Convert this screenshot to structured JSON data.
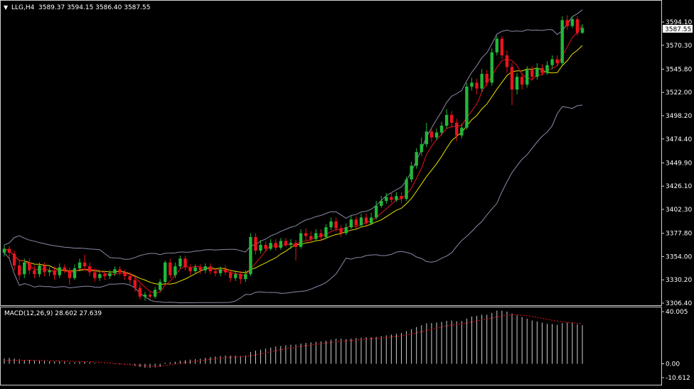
{
  "header": {
    "marker": "▼",
    "symbol": "LLG,H4",
    "ohlc": "3589.37 3594.15 3586.40 3587.55"
  },
  "price_axis": {
    "ticks": [
      "3594.10",
      "3570.30",
      "3545.80",
      "3522.00",
      "3498.20",
      "3474.40",
      "3449.90",
      "3426.10",
      "3402.30",
      "3377.80",
      "3354.00",
      "3330.20",
      "3306.40"
    ],
    "current_label": "3587.55"
  },
  "macd": {
    "label": "MACD(12,26,9) 28.602 27.639",
    "ticks": [
      "40.005",
      "0.00",
      "-10.612"
    ]
  },
  "colors": {
    "bull": "#22b83a",
    "bear": "#e8141e",
    "fast_ma": "#e8141e",
    "slow_ma": "#e6e000",
    "bands": "#8a8aa8",
    "hist": "#cfcfcf",
    "signal": "#e8141e"
  },
  "chart_data": {
    "type": "candlestick",
    "timeframe": "H4",
    "ylim": [
      3306.4,
      3606
    ],
    "candles": [
      {
        "o": 3358,
        "c": 3362,
        "h": 3366,
        "l": 3354
      },
      {
        "o": 3362,
        "c": 3358,
        "h": 3365,
        "l": 3352
      },
      {
        "o": 3357,
        "c": 3345,
        "h": 3360,
        "l": 3340
      },
      {
        "o": 3345,
        "c": 3335,
        "h": 3350,
        "l": 3330
      },
      {
        "o": 3336,
        "c": 3348,
        "h": 3352,
        "l": 3332
      },
      {
        "o": 3348,
        "c": 3340,
        "h": 3352,
        "l": 3336
      },
      {
        "o": 3340,
        "c": 3336,
        "h": 3345,
        "l": 3332
      },
      {
        "o": 3336,
        "c": 3345,
        "h": 3348,
        "l": 3333
      },
      {
        "o": 3345,
        "c": 3338,
        "h": 3348,
        "l": 3334
      },
      {
        "o": 3338,
        "c": 3340,
        "h": 3343,
        "l": 3334
      },
      {
        "o": 3340,
        "c": 3335,
        "h": 3344,
        "l": 3330
      },
      {
        "o": 3335,
        "c": 3343,
        "h": 3347,
        "l": 3332
      },
      {
        "o": 3343,
        "c": 3340,
        "h": 3346,
        "l": 3337
      },
      {
        "o": 3340,
        "c": 3332,
        "h": 3343,
        "l": 3325
      },
      {
        "o": 3332,
        "c": 3342,
        "h": 3346,
        "l": 3330
      },
      {
        "o": 3342,
        "c": 3348,
        "h": 3352,
        "l": 3339
      },
      {
        "o": 3348,
        "c": 3344,
        "h": 3356,
        "l": 3340
      },
      {
        "o": 3344,
        "c": 3338,
        "h": 3348,
        "l": 3334
      },
      {
        "o": 3338,
        "c": 3332,
        "h": 3342,
        "l": 3328
      },
      {
        "o": 3332,
        "c": 3336,
        "h": 3340,
        "l": 3329
      },
      {
        "o": 3336,
        "c": 3334,
        "h": 3339,
        "l": 3330
      },
      {
        "o": 3334,
        "c": 3337,
        "h": 3340,
        "l": 3331
      },
      {
        "o": 3337,
        "c": 3341,
        "h": 3344,
        "l": 3334
      },
      {
        "o": 3341,
        "c": 3338,
        "h": 3344,
        "l": 3335
      },
      {
        "o": 3338,
        "c": 3334,
        "h": 3341,
        "l": 3330
      },
      {
        "o": 3334,
        "c": 3330,
        "h": 3338,
        "l": 3326
      },
      {
        "o": 3330,
        "c": 3322,
        "h": 3333,
        "l": 3318
      },
      {
        "o": 3322,
        "c": 3313,
        "h": 3326,
        "l": 3310
      },
      {
        "o": 3313,
        "c": 3315,
        "h": 3318,
        "l": 3309
      },
      {
        "o": 3315,
        "c": 3313,
        "h": 3318,
        "l": 3310
      },
      {
        "o": 3313,
        "c": 3320,
        "h": 3323,
        "l": 3311
      },
      {
        "o": 3320,
        "c": 3328,
        "h": 3331,
        "l": 3318
      },
      {
        "o": 3328,
        "c": 3348,
        "h": 3350,
        "l": 3326
      },
      {
        "o": 3348,
        "c": 3335,
        "h": 3352,
        "l": 3332
      },
      {
        "o": 3335,
        "c": 3344,
        "h": 3348,
        "l": 3332
      },
      {
        "o": 3344,
        "c": 3352,
        "h": 3355,
        "l": 3342
      },
      {
        "o": 3352,
        "c": 3343,
        "h": 3355,
        "l": 3340
      },
      {
        "o": 3343,
        "c": 3339,
        "h": 3346,
        "l": 3335
      },
      {
        "o": 3339,
        "c": 3343,
        "h": 3346,
        "l": 3336
      },
      {
        "o": 3343,
        "c": 3340,
        "h": 3346,
        "l": 3336
      },
      {
        "o": 3340,
        "c": 3344,
        "h": 3347,
        "l": 3337
      },
      {
        "o": 3344,
        "c": 3339,
        "h": 3347,
        "l": 3336
      },
      {
        "o": 3339,
        "c": 3337,
        "h": 3342,
        "l": 3334
      },
      {
        "o": 3337,
        "c": 3341,
        "h": 3344,
        "l": 3334
      },
      {
        "o": 3341,
        "c": 3338,
        "h": 3345,
        "l": 3335
      },
      {
        "o": 3338,
        "c": 3332,
        "h": 3341,
        "l": 3328
      },
      {
        "o": 3332,
        "c": 3336,
        "h": 3340,
        "l": 3329
      },
      {
        "o": 3336,
        "c": 3331,
        "h": 3339,
        "l": 3326
      },
      {
        "o": 3331,
        "c": 3336,
        "h": 3340,
        "l": 3328
      },
      {
        "o": 3336,
        "c": 3374,
        "h": 3378,
        "l": 3334
      },
      {
        "o": 3374,
        "c": 3360,
        "h": 3378,
        "l": 3356
      },
      {
        "o": 3360,
        "c": 3366,
        "h": 3371,
        "l": 3357
      },
      {
        "o": 3366,
        "c": 3362,
        "h": 3370,
        "l": 3359
      },
      {
        "o": 3362,
        "c": 3368,
        "h": 3372,
        "l": 3360
      },
      {
        "o": 3368,
        "c": 3363,
        "h": 3372,
        "l": 3360
      },
      {
        "o": 3363,
        "c": 3370,
        "h": 3373,
        "l": 3361
      },
      {
        "o": 3370,
        "c": 3366,
        "h": 3373,
        "l": 3364
      },
      {
        "o": 3366,
        "c": 3368,
        "h": 3372,
        "l": 3362
      },
      {
        "o": 3368,
        "c": 3364,
        "h": 3371,
        "l": 3350
      },
      {
        "o": 3364,
        "c": 3378,
        "h": 3382,
        "l": 3362
      },
      {
        "o": 3378,
        "c": 3375,
        "h": 3383,
        "l": 3371
      },
      {
        "o": 3375,
        "c": 3372,
        "h": 3380,
        "l": 3368
      },
      {
        "o": 3372,
        "c": 3378,
        "h": 3382,
        "l": 3370
      },
      {
        "o": 3378,
        "c": 3374,
        "h": 3382,
        "l": 3370
      },
      {
        "o": 3374,
        "c": 3384,
        "h": 3387,
        "l": 3372
      },
      {
        "o": 3384,
        "c": 3390,
        "h": 3394,
        "l": 3381
      },
      {
        "o": 3390,
        "c": 3383,
        "h": 3394,
        "l": 3380
      },
      {
        "o": 3383,
        "c": 3378,
        "h": 3386,
        "l": 3374
      },
      {
        "o": 3378,
        "c": 3384,
        "h": 3388,
        "l": 3376
      },
      {
        "o": 3384,
        "c": 3392,
        "h": 3396,
        "l": 3382
      },
      {
        "o": 3392,
        "c": 3386,
        "h": 3395,
        "l": 3383
      },
      {
        "o": 3386,
        "c": 3394,
        "h": 3398,
        "l": 3384
      },
      {
        "o": 3394,
        "c": 3388,
        "h": 3398,
        "l": 3385
      },
      {
        "o": 3388,
        "c": 3394,
        "h": 3399,
        "l": 3386
      },
      {
        "o": 3394,
        "c": 3406,
        "h": 3411,
        "l": 3392
      },
      {
        "o": 3406,
        "c": 3411,
        "h": 3416,
        "l": 3404
      },
      {
        "o": 3411,
        "c": 3415,
        "h": 3419,
        "l": 3408
      },
      {
        "o": 3415,
        "c": 3412,
        "h": 3420,
        "l": 3409
      },
      {
        "o": 3412,
        "c": 3416,
        "h": 3420,
        "l": 3410
      },
      {
        "o": 3416,
        "c": 3413,
        "h": 3420,
        "l": 3409
      },
      {
        "o": 3413,
        "c": 3433,
        "h": 3436,
        "l": 3411
      },
      {
        "o": 3433,
        "c": 3447,
        "h": 3451,
        "l": 3430
      },
      {
        "o": 3447,
        "c": 3461,
        "h": 3465,
        "l": 3444
      },
      {
        "o": 3461,
        "c": 3469,
        "h": 3476,
        "l": 3457
      },
      {
        "o": 3469,
        "c": 3482,
        "h": 3491,
        "l": 3466
      },
      {
        "o": 3482,
        "c": 3476,
        "h": 3486,
        "l": 3471
      },
      {
        "o": 3476,
        "c": 3481,
        "h": 3485,
        "l": 3473
      },
      {
        "o": 3481,
        "c": 3488,
        "h": 3492,
        "l": 3478
      },
      {
        "o": 3488,
        "c": 3499,
        "h": 3505,
        "l": 3485
      },
      {
        "o": 3499,
        "c": 3491,
        "h": 3503,
        "l": 3486
      },
      {
        "o": 3491,
        "c": 3478,
        "h": 3495,
        "l": 3472
      },
      {
        "o": 3478,
        "c": 3486,
        "h": 3490,
        "l": 3475
      },
      {
        "o": 3486,
        "c": 3528,
        "h": 3532,
        "l": 3484
      },
      {
        "o": 3528,
        "c": 3532,
        "h": 3537,
        "l": 3524
      },
      {
        "o": 3532,
        "c": 3526,
        "h": 3536,
        "l": 3520
      },
      {
        "o": 3526,
        "c": 3541,
        "h": 3546,
        "l": 3523
      },
      {
        "o": 3541,
        "c": 3532,
        "h": 3545,
        "l": 3528
      },
      {
        "o": 3532,
        "c": 3563,
        "h": 3567,
        "l": 3529
      },
      {
        "o": 3563,
        "c": 3577,
        "h": 3580,
        "l": 3560
      },
      {
        "o": 3577,
        "c": 3560,
        "h": 3580,
        "l": 3556
      },
      {
        "o": 3560,
        "c": 3548,
        "h": 3565,
        "l": 3542
      },
      {
        "o": 3548,
        "c": 3525,
        "h": 3552,
        "l": 3509
      },
      {
        "o": 3525,
        "c": 3538,
        "h": 3542,
        "l": 3520
      },
      {
        "o": 3538,
        "c": 3530,
        "h": 3542,
        "l": 3525
      },
      {
        "o": 3530,
        "c": 3545,
        "h": 3549,
        "l": 3527
      },
      {
        "o": 3545,
        "c": 3538,
        "h": 3549,
        "l": 3534
      },
      {
        "o": 3538,
        "c": 3547,
        "h": 3552,
        "l": 3535
      },
      {
        "o": 3547,
        "c": 3542,
        "h": 3551,
        "l": 3539
      },
      {
        "o": 3542,
        "c": 3550,
        "h": 3554,
        "l": 3540
      },
      {
        "o": 3550,
        "c": 3556,
        "h": 3560,
        "l": 3546
      },
      {
        "o": 3556,
        "c": 3552,
        "h": 3560,
        "l": 3549
      },
      {
        "o": 3552,
        "c": 3596,
        "h": 3600,
        "l": 3550
      },
      {
        "o": 3596,
        "c": 3590,
        "h": 3601,
        "l": 3586
      },
      {
        "o": 3590,
        "c": 3597,
        "h": 3600,
        "l": 3588
      },
      {
        "o": 3597,
        "c": 3583,
        "h": 3600,
        "l": 3580
      },
      {
        "o": 3583,
        "c": 3588,
        "h": 3592,
        "l": 3582
      }
    ],
    "macd_hist": [
      4,
      4.5,
      4,
      3.5,
      3,
      3,
      2.6,
      2.4,
      2.3,
      2,
      1.8,
      1.8,
      1.6,
      1,
      1.2,
      1.5,
      1.7,
      1.2,
      0.6,
      0.2,
      -0.1,
      -0.2,
      -0.2,
      -0.4,
      -0.6,
      -0.9,
      -1.6,
      -2.4,
      -3,
      -3.2,
      -2.8,
      -2.2,
      0.8,
      1.2,
      1.6,
      2.4,
      2.8,
      3.2,
      3.6,
      4,
      4.6,
      5.2,
      5.6,
      6,
      6.3,
      6.3,
      6.1,
      6,
      6.4,
      9,
      10.1,
      10.8,
      11.6,
      12.4,
      13.2,
      13.6,
      14.2,
      14.6,
      14.8,
      15.5,
      16,
      16.4,
      16.8,
      17.2,
      17.6,
      18.4,
      19.2,
      19.2,
      19,
      19.3,
      19.8,
      20,
      20.4,
      20.3,
      20.6,
      21.2,
      21.8,
      22.4,
      23,
      23.6,
      25,
      26.6,
      28.2,
      29.6,
      31,
      31.2,
      31.6,
      32.2,
      33,
      33.2,
      32.6,
      32.8,
      34.6,
      36.2,
      36.8,
      37.6,
      37.6,
      39,
      40.8,
      40.8,
      40.1,
      38.6,
      37.2,
      35.8,
      34.6,
      33.2,
      32.4,
      31.6,
      30.6,
      30.4,
      29.8,
      31.2,
      31.6,
      31.6,
      30.2,
      29.5
    ],
    "macd_signal": [
      2.5,
      2.6,
      2.7,
      2.7,
      2.7,
      2.7,
      2.6,
      2.6,
      2.5,
      2.4,
      2.3,
      2.2,
      2.1,
      2,
      1.9,
      1.8,
      1.7,
      1.6,
      1.4,
      1.2,
      0.9,
      0.6,
      0.3,
      0,
      -0.3,
      -0.6,
      -0.9,
      -1.2,
      -1.6,
      -1.9,
      -2,
      -1.9,
      -1.3,
      -0.8,
      -0.2,
      0.4,
      0.9,
      1.4,
      1.9,
      2.4,
      2.9,
      3.4,
      3.9,
      4.3,
      4.7,
      5,
      5.2,
      5.4,
      5.6,
      6.1,
      6.9,
      7.7,
      8.5,
      9.3,
      10.1,
      10.8,
      11.5,
      12.1,
      12.7,
      13.3,
      13.9,
      14.4,
      14.9,
      15.4,
      15.9,
      16.4,
      16.9,
      17.3,
      17.6,
      17.9,
      18.3,
      18.6,
      18.9,
      19.2,
      19.5,
      19.8,
      20.2,
      20.6,
      21,
      21.5,
      22.1,
      22.8,
      23.7,
      24.6,
      25.6,
      26.5,
      27.4,
      28.2,
      29,
      29.7,
      30.2,
      30.7,
      31.3,
      32,
      32.8,
      33.6,
      34.3,
      35,
      35.9,
      36.7,
      37.3,
      37.6,
      37.6,
      37.3,
      36.9,
      36.3,
      35.6,
      34.9,
      34.1,
      33.4,
      32.7,
      32.2,
      31.8,
      31.5,
      31.1,
      30.8
    ]
  }
}
